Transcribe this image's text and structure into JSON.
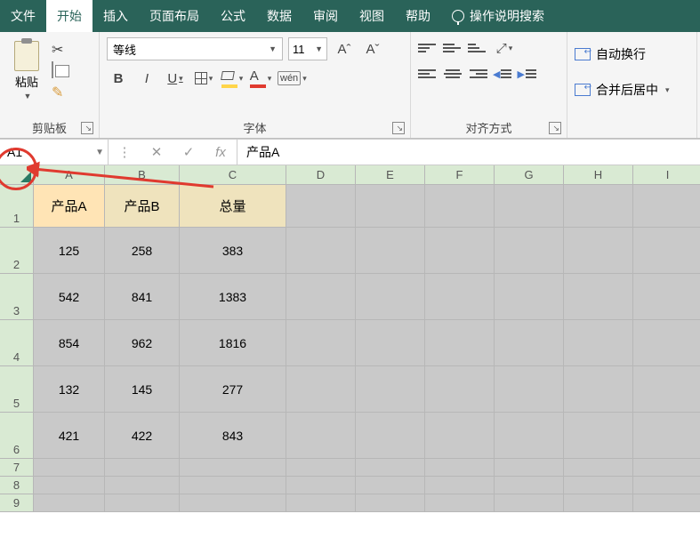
{
  "menu": {
    "file": "文件",
    "home": "开始",
    "insert": "插入",
    "layout": "页面布局",
    "formula": "公式",
    "data": "数据",
    "review": "审阅",
    "view": "视图",
    "help": "帮助",
    "tellme": "操作说明搜索"
  },
  "ribbon": {
    "clipboard": {
      "paste": "粘贴",
      "group_label": "剪贴板"
    },
    "font": {
      "name": "等线",
      "size": "11",
      "group_label": "字体",
      "bold": "B",
      "italic": "I",
      "underline": "U",
      "grow": "A",
      "shrink": "A",
      "fontcolor_letter": "A",
      "phonetic": "wén"
    },
    "align": {
      "group_label": "对齐方式",
      "rotate": "ab"
    },
    "wrap": {
      "wrap_text": "自动换行",
      "merge_center": "合并后居中"
    }
  },
  "namebox": {
    "ref": "A1"
  },
  "formula": {
    "value": "产品A",
    "fx": "fx",
    "cancel": "✕",
    "enter": "✓",
    "expand": "⋮"
  },
  "columns": [
    "A",
    "B",
    "C",
    "D",
    "E",
    "F",
    "G",
    "H",
    "I"
  ],
  "rows": [
    "1",
    "2",
    "3",
    "4",
    "5",
    "6",
    "7",
    "8",
    "9"
  ],
  "headers": {
    "a": "产品A",
    "b": "产品B",
    "c": "总量"
  },
  "data_rows": [
    {
      "a": "125",
      "b": "258",
      "c": "383"
    },
    {
      "a": "542",
      "b": "841",
      "c": "1383"
    },
    {
      "a": "854",
      "b": "962",
      "c": "1816"
    },
    {
      "a": "132",
      "b": "145",
      "c": "277"
    },
    {
      "a": "421",
      "b": "422",
      "c": "843"
    }
  ]
}
